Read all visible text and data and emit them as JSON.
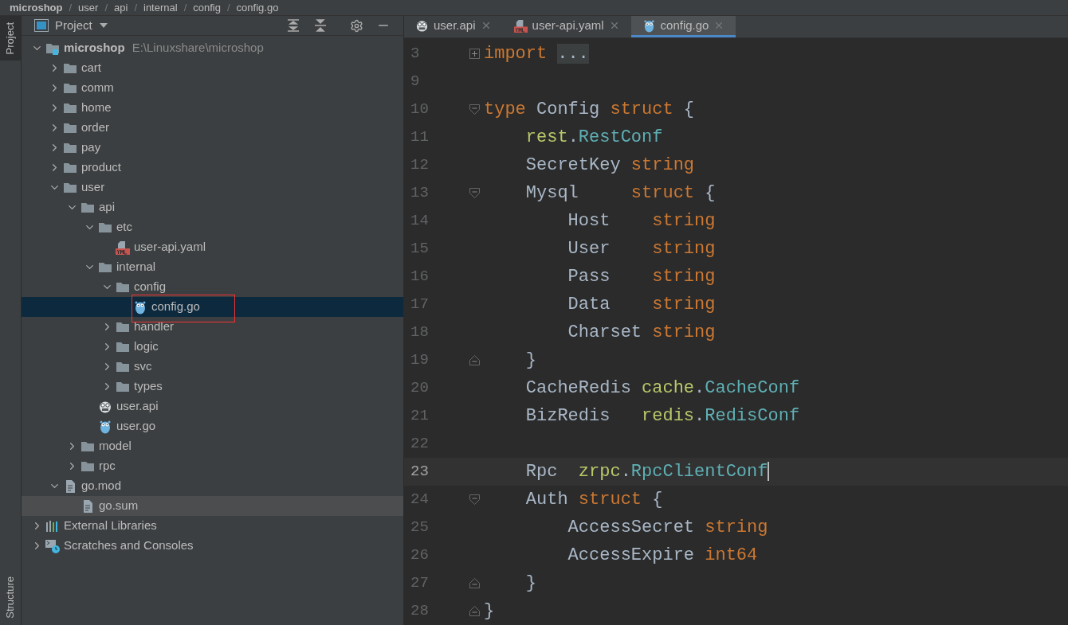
{
  "breadcrumb": {
    "separator": "/",
    "items": [
      "microshop",
      "user",
      "api",
      "internal",
      "config",
      "config.go"
    ]
  },
  "side_tabs": [
    {
      "label": "Project",
      "selected": true
    },
    {
      "label": "Structure",
      "selected": false
    }
  ],
  "project_panel": {
    "title": "Project"
  },
  "tree": [
    {
      "label": "microshop",
      "note": "E:\\Linuxshare\\microshop",
      "kind": "module",
      "expanded": true,
      "selected": false,
      "children": [
        {
          "label": "cart",
          "kind": "folder",
          "expanded": false,
          "selected": false
        },
        {
          "label": "comm",
          "kind": "folder",
          "expanded": false,
          "selected": false
        },
        {
          "label": "home",
          "kind": "folder",
          "expanded": false,
          "selected": false
        },
        {
          "label": "order",
          "kind": "folder",
          "expanded": false,
          "selected": false
        },
        {
          "label": "pay",
          "kind": "folder",
          "expanded": false,
          "selected": false
        },
        {
          "label": "product",
          "kind": "folder",
          "expanded": false,
          "selected": false
        },
        {
          "label": "user",
          "kind": "folder",
          "expanded": true,
          "selected": false,
          "children": [
            {
              "label": "api",
              "kind": "folder",
              "expanded": true,
              "selected": false,
              "children": [
                {
                  "label": "etc",
                  "kind": "folder",
                  "expanded": true,
                  "selected": false,
                  "children": [
                    {
                      "label": "user-api.yaml",
                      "kind": "yaml",
                      "selected": false
                    }
                  ]
                },
                {
                  "label": "internal",
                  "kind": "folder",
                  "expanded": true,
                  "selected": false,
                  "children": [
                    {
                      "label": "config",
                      "kind": "folder",
                      "expanded": true,
                      "selected": false,
                      "children": [
                        {
                          "label": "config.go",
                          "kind": "go",
                          "selected": true,
                          "marked": true
                        }
                      ]
                    },
                    {
                      "label": "handler",
                      "kind": "folder",
                      "expanded": false,
                      "selected": false
                    },
                    {
                      "label": "logic",
                      "kind": "folder",
                      "expanded": false,
                      "selected": false
                    },
                    {
                      "label": "svc",
                      "kind": "folder",
                      "expanded": false,
                      "selected": false
                    },
                    {
                      "label": "types",
                      "kind": "folder",
                      "expanded": false,
                      "selected": false
                    }
                  ]
                },
                {
                  "label": "user.api",
                  "kind": "api",
                  "selected": false
                },
                {
                  "label": "user.go",
                  "kind": "go",
                  "selected": false
                }
              ]
            },
            {
              "label": "model",
              "kind": "folder",
              "expanded": false,
              "selected": false
            },
            {
              "label": "rpc",
              "kind": "folder",
              "expanded": false,
              "selected": false
            }
          ]
        },
        {
          "label": "go.mod",
          "kind": "file",
          "expanded": true,
          "selected": false,
          "children": [
            {
              "label": "go.sum",
              "kind": "file",
              "selected": false,
              "hovered": true
            }
          ]
        }
      ]
    },
    {
      "label": "External Libraries",
      "kind": "libraries",
      "expanded": false,
      "selected": false
    },
    {
      "label": "Scratches and Consoles",
      "kind": "scratches",
      "expanded": false,
      "selected": false
    }
  ],
  "editor_tabs": [
    {
      "label": "user.api",
      "kind": "api",
      "selected": false
    },
    {
      "label": "user-api.yaml",
      "kind": "yaml",
      "selected": false
    },
    {
      "label": "config.go",
      "kind": "go",
      "selected": true
    }
  ],
  "code": [
    {
      "number": "3",
      "kind": "collapsed",
      "tokens": [
        {
          "text": "import",
          "kind": "keyword"
        },
        {
          "text": "...",
          "kind": "folded"
        }
      ]
    },
    {
      "number": "9",
      "kind": "plain"
    },
    {
      "number": "10",
      "kind": "fold_start",
      "tokens": [
        {
          "text": "type",
          "kind": "keyword"
        },
        {
          "text": " Config ",
          "kind": "plain"
        },
        {
          "text": "struct",
          "kind": "keyword"
        },
        {
          "text": " {",
          "kind": "plain"
        }
      ]
    },
    {
      "number": "11",
      "kind": "plain",
      "tokens": [
        {
          "text": "    rest",
          "kind": "package"
        },
        {
          "text": ".",
          "kind": "plain"
        },
        {
          "text": "RestConf",
          "kind": "type"
        }
      ]
    },
    {
      "number": "12",
      "kind": "plain",
      "tokens": [
        {
          "text": "    SecretKey ",
          "kind": "plain"
        },
        {
          "text": "string",
          "kind": "keyword"
        }
      ]
    },
    {
      "number": "13",
      "kind": "fold_start",
      "tokens": [
        {
          "text": "    Mysql     ",
          "kind": "plain"
        },
        {
          "text": "struct",
          "kind": "keyword"
        },
        {
          "text": " {",
          "kind": "plain"
        }
      ]
    },
    {
      "number": "14",
      "kind": "plain",
      "tokens": [
        {
          "text": "        Host    ",
          "kind": "plain"
        },
        {
          "text": "string",
          "kind": "keyword"
        }
      ]
    },
    {
      "number": "15",
      "kind": "plain",
      "tokens": [
        {
          "text": "        User    ",
          "kind": "plain"
        },
        {
          "text": "string",
          "kind": "keyword"
        }
      ]
    },
    {
      "number": "16",
      "kind": "plain",
      "tokens": [
        {
          "text": "        Pass    ",
          "kind": "plain"
        },
        {
          "text": "string",
          "kind": "keyword"
        }
      ]
    },
    {
      "number": "17",
      "kind": "plain",
      "tokens": [
        {
          "text": "        Data    ",
          "kind": "plain"
        },
        {
          "text": "string",
          "kind": "keyword"
        }
      ]
    },
    {
      "number": "18",
      "kind": "plain",
      "tokens": [
        {
          "text": "        Charset ",
          "kind": "plain"
        },
        {
          "text": "string",
          "kind": "keyword"
        }
      ]
    },
    {
      "number": "19",
      "kind": "fold_end",
      "tokens": [
        {
          "text": "    }",
          "kind": "plain"
        }
      ]
    },
    {
      "number": "20",
      "kind": "plain",
      "tokens": [
        {
          "text": "    CacheRedis ",
          "kind": "plain"
        },
        {
          "text": "cache",
          "kind": "package"
        },
        {
          "text": ".",
          "kind": "plain"
        },
        {
          "text": "CacheConf",
          "kind": "type"
        }
      ]
    },
    {
      "number": "21",
      "kind": "plain",
      "tokens": [
        {
          "text": "    BizRedis   ",
          "kind": "plain"
        },
        {
          "text": "redis",
          "kind": "package"
        },
        {
          "text": ".",
          "kind": "plain"
        },
        {
          "text": "RedisConf",
          "kind": "type"
        }
      ]
    },
    {
      "number": "22",
      "kind": "plain"
    },
    {
      "number": "23",
      "kind": "plain",
      "current": true,
      "tokens": [
        {
          "text": "    Rpc  ",
          "kind": "plain"
        },
        {
          "text": "zrpc",
          "kind": "package"
        },
        {
          "text": ".",
          "kind": "plain"
        },
        {
          "text": "RpcClientConf",
          "kind": "type"
        }
      ]
    },
    {
      "number": "24",
      "kind": "fold_start",
      "tokens": [
        {
          "text": "    Auth ",
          "kind": "plain"
        },
        {
          "text": "struct",
          "kind": "keyword"
        },
        {
          "text": " {",
          "kind": "plain"
        }
      ]
    },
    {
      "number": "25",
      "kind": "plain",
      "tokens": [
        {
          "text": "        AccessSecret ",
          "kind": "plain"
        },
        {
          "text": "string",
          "kind": "keyword"
        }
      ]
    },
    {
      "number": "26",
      "kind": "plain",
      "tokens": [
        {
          "text": "        AccessExpire ",
          "kind": "plain"
        },
        {
          "text": "int64",
          "kind": "keyword"
        }
      ]
    },
    {
      "number": "27",
      "kind": "fold_end",
      "tokens": [
        {
          "text": "    }",
          "kind": "plain"
        }
      ]
    },
    {
      "number": "28",
      "kind": "fold_end",
      "tokens": [
        {
          "text": "}",
          "kind": "plain"
        }
      ]
    }
  ]
}
